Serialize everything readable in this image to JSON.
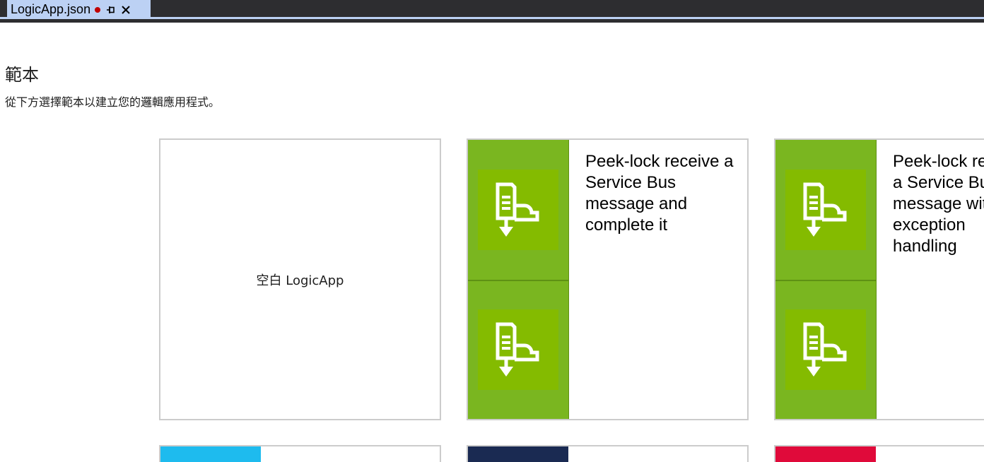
{
  "tab": {
    "title": "LogicApp.json",
    "icons": {
      "dirty": "unsaved-dot",
      "pin": "pin-icon",
      "close": "close-icon"
    }
  },
  "header": {
    "title": "範本",
    "subtitle": "從下方選擇範本以建立您的邏輯應用程式。"
  },
  "templates": [
    {
      "label": "空白 LogicApp",
      "kind": "blank"
    },
    {
      "label": "Peek-lock receive a Service Bus message and complete it",
      "kind": "template",
      "color": "#7ab620",
      "icons": [
        "service-bus-receive-icon",
        "service-bus-receive-icon"
      ]
    },
    {
      "label": "Peek-lock receive a Service Bus message with exception handling",
      "kind": "template",
      "color": "#7ab620",
      "icons": [
        "service-bus-receive-icon",
        "service-bus-receive-icon"
      ]
    }
  ],
  "second_row_colors": [
    "#1ebbee",
    "#1a2a52",
    "#e00a3a"
  ]
}
